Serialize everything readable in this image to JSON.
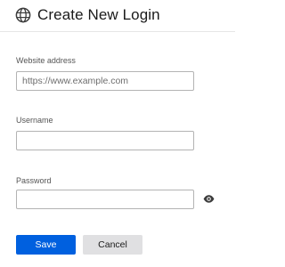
{
  "header": {
    "title": "Create New Login",
    "icon": "globe-icon"
  },
  "form": {
    "website": {
      "label": "Website address",
      "placeholder": "https://www.example.com",
      "value": ""
    },
    "username": {
      "label": "Username",
      "value": ""
    },
    "password": {
      "label": "Password",
      "value": "",
      "reveal_icon": "eye-icon"
    }
  },
  "actions": {
    "save_label": "Save",
    "cancel_label": "Cancel"
  },
  "colors": {
    "primary": "#0060df",
    "secondary": "#e0e0e2",
    "border": "#b3b3b3"
  }
}
